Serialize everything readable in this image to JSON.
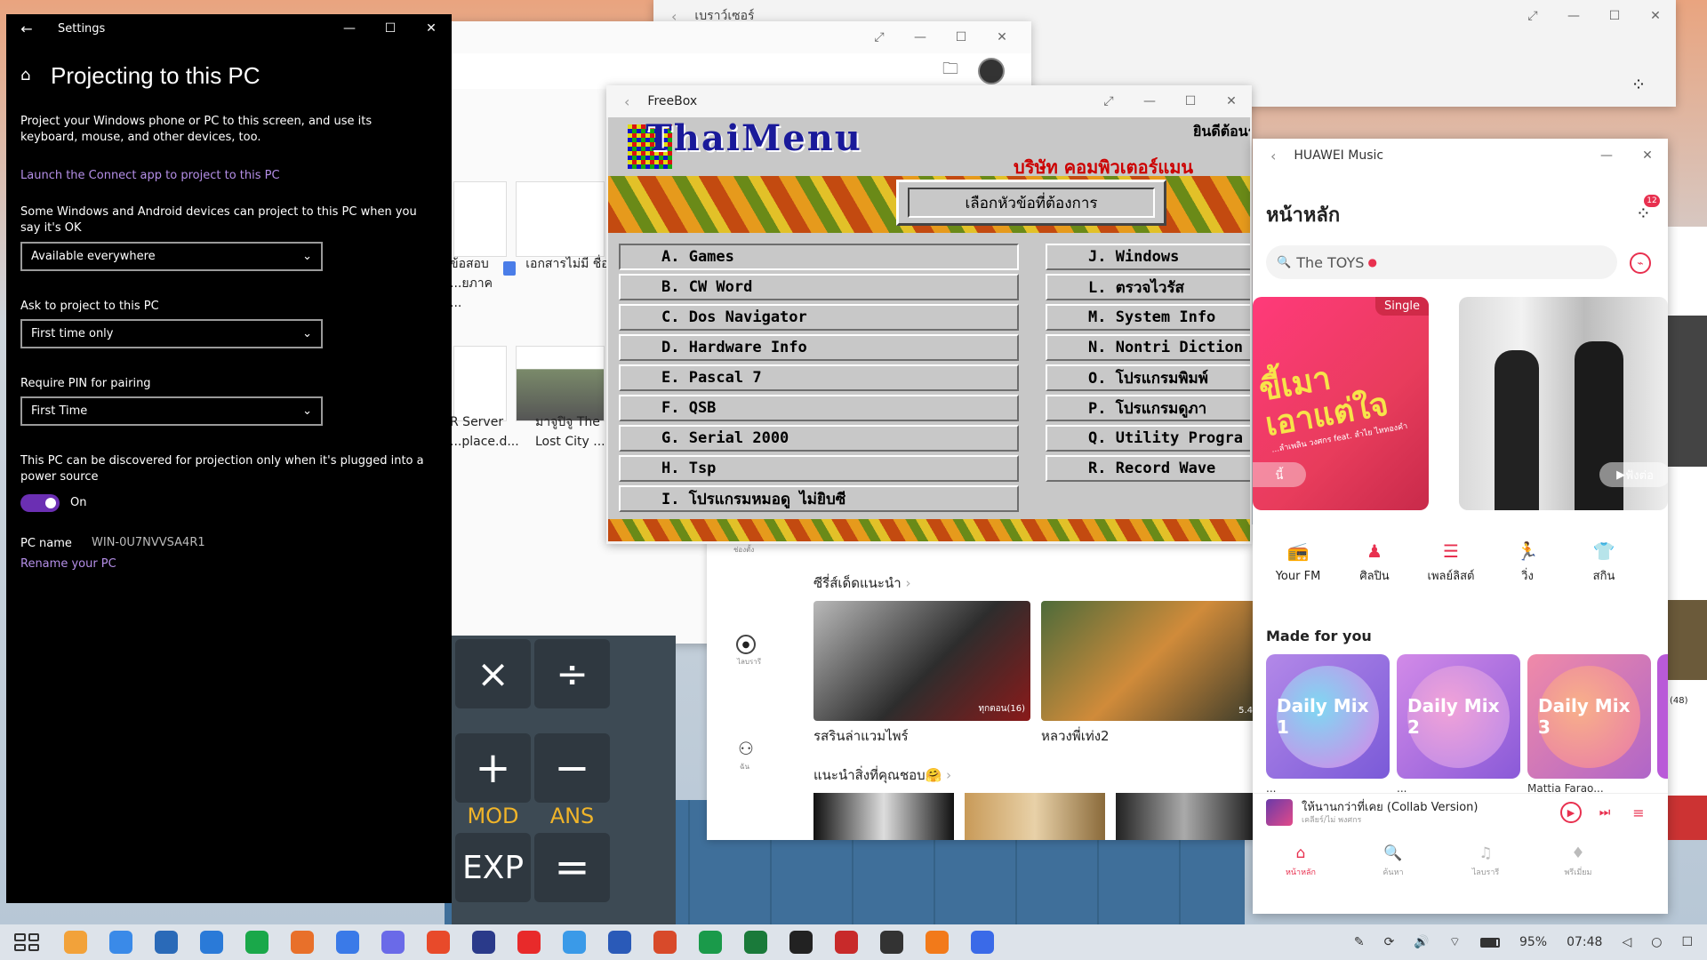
{
  "desktop": {
    "accent": "#6b2fb3"
  },
  "browser_window": {
    "title": "เบราว์เซอร์"
  },
  "files_window": {
    "files": [
      {
        "name": "ข้อสอบ ...ยภาค ..."
      },
      {
        "name": "เอกสารไม่มี ชื่อ"
      },
      {
        "name": "R Server ...place.d..."
      },
      {
        "name": "มาจูปิจู The Lost City ..."
      }
    ]
  },
  "settings": {
    "window_title": "Settings",
    "page_title": "Projecting to this PC",
    "intro": "Project your Windows phone or PC to this screen, and use its keyboard, mouse, and other devices, too.",
    "connect_link": "Launch the Connect app to project to this PC",
    "section1_text": "Some Windows and Android devices can project to this PC when you say it's OK",
    "section1_value": "Available everywhere",
    "section2_label": "Ask to project to this PC",
    "section2_value": "First time only",
    "section3_label": "Require PIN for pairing",
    "section3_value": "First Time",
    "power_text": "This PC can be discovered for projection only when it's plugged into a power source",
    "toggle_label": "On",
    "pc_name_label": "PC name",
    "pc_name_value": "WIN-0U7NVVSA4R1",
    "rename_link": "Rename your PC"
  },
  "calculator": {
    "keys": [
      "×",
      "÷",
      "+",
      "−",
      "MOD",
      "ANS",
      "EXP",
      "="
    ]
  },
  "video_app": {
    "nav_labels": [
      "ช่องตั้ง",
      "ไลบรารี",
      "ฉัน"
    ],
    "section1": "ซีรี่ส์เด็ดแนะนำ",
    "movies": [
      {
        "title": "รสรินล่าแวมไพร์",
        "badge": "ทุกตอน(16)"
      },
      {
        "title": "หลวงพี่เท่ง2",
        "badge": "5.4"
      }
    ],
    "section2": "แนะนำสิ่งที่คุณชอบ🤗"
  },
  "thaimenu": {
    "window_title": "FreeBox",
    "logo": "ThaiMenu",
    "welcome": "ยินดีต้อนรับสู่ระบบไทยเมนู",
    "company": "บริษัท คอมพิวเตอร์แมน",
    "prompt": "เลือกหัวข้อที่ต้องการ",
    "left_items": [
      "A. Games",
      "B. CW Word",
      "C. Dos Navigator",
      "D. Hardware Info",
      "E. Pascal 7",
      "F. QSB",
      "G. Serial 2000",
      "H. Tsp",
      "I. โปรแกรมหมอดู ไม่ยิบซี"
    ],
    "right_items": [
      "J. Windows",
      "L. ตรวจไวรัส",
      "M. System Info",
      "N. Nontri Diction",
      "O. โปรแกรมพิมพ์",
      "P. โปรแกรมดูภา",
      "Q. Utility Progra",
      "R. Record Wave"
    ]
  },
  "music": {
    "window_title": "HUAWEI Music",
    "page_title": "หน้าหลัก",
    "notif_count": "12",
    "search_text": "The TOYS",
    "banner_tag": "Single",
    "banner_text": "ขี้เมาเอาแต่ใจ",
    "banner_sub": "...ลำเพลิน วงศกร feat. ลำไย ไหทองคำ",
    "banner_button_left": "นี้",
    "banner_button_right": "ฟังต่อ",
    "quick": [
      {
        "label": "Your FM",
        "icon": "radio-icon"
      },
      {
        "label": "ศิลปิน",
        "icon": "artist-icon"
      },
      {
        "label": "เพลย์ลิสต์",
        "icon": "playlist-icon"
      },
      {
        "label": "วิ่ง",
        "icon": "run-icon"
      },
      {
        "label": "สกิน",
        "icon": "shirt-icon"
      }
    ],
    "made_for_you": "Made for you",
    "mixes": [
      "Daily Mix 1",
      "Daily Mix 2",
      "Daily Mix 3"
    ],
    "mix_subs": [
      "...",
      "...",
      "Mattia Farao..."
    ],
    "side_badge": "(48)",
    "now_playing_title": "ให้นานกว่าที่เคย (Collab Version)",
    "now_playing_artist": "เคลียร์/ไม่ พงศกร",
    "tabs": [
      "หน้าหลัก",
      "ค้นหา",
      "ไลบรารี",
      "พรีเมี่ยม"
    ],
    "colors": {
      "accent": "#e8304f"
    }
  },
  "taskbar": {
    "battery": "95%",
    "time": "07:48"
  }
}
